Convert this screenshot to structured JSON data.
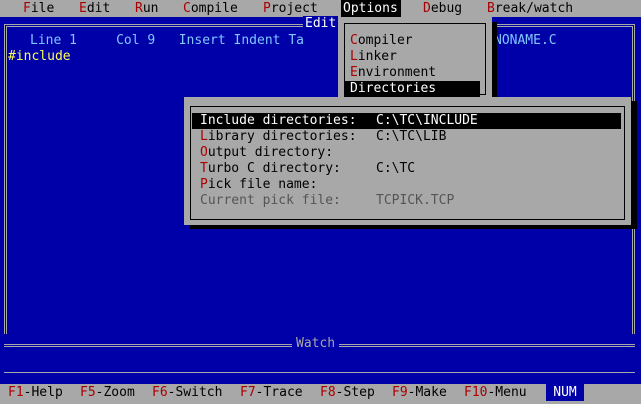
{
  "menubar": {
    "items": [
      {
        "hotkey": "F",
        "rest": "ile"
      },
      {
        "hotkey": "E",
        "rest": "dit"
      },
      {
        "hotkey": "R",
        "rest": "un"
      },
      {
        "hotkey": "C",
        "rest": "ompile"
      },
      {
        "hotkey": "P",
        "rest": "roject"
      },
      {
        "hotkey": "O",
        "rest": "ptions"
      },
      {
        "hotkey": "D",
        "rest": "ebug"
      },
      {
        "hotkey": "B",
        "rest": "reak/watch"
      }
    ],
    "active": "Options"
  },
  "edit_window": {
    "title": "Edit",
    "status": {
      "line": "Line 1",
      "col": "Col 9",
      "insert": "Insert",
      "indent": "Indent",
      "tab": "Ta"
    },
    "file_name": "NONAME.C",
    "content": "#include"
  },
  "options_menu": {
    "items": [
      {
        "hotkey": "C",
        "rest": "ompiler"
      },
      {
        "hotkey": "L",
        "rest": "inker"
      },
      {
        "hotkey": "E",
        "rest": "nvironment"
      },
      {
        "hotkey": "D",
        "rest": "irectories"
      }
    ],
    "selected": "Directories"
  },
  "directories_dialog": {
    "rows": [
      {
        "hotkey": "I",
        "rest": "nclude directories:",
        "value": "C:\\TC\\INCLUDE",
        "selected": true,
        "disabled": false
      },
      {
        "hotkey": "L",
        "rest": "ibrary directories:",
        "value": "C:\\TC\\LIB",
        "selected": false,
        "disabled": false
      },
      {
        "hotkey": "O",
        "rest": "utput directory:",
        "value": "",
        "selected": false,
        "disabled": false
      },
      {
        "hotkey": "T",
        "rest": "urbo C directory:",
        "value": "C:\\TC",
        "selected": false,
        "disabled": false
      },
      {
        "hotkey": "P",
        "rest": "ick file name:",
        "value": "",
        "selected": false,
        "disabled": false
      },
      {
        "hotkey": "",
        "rest": "Current pick file:",
        "value": "TCPICK.TCP",
        "selected": false,
        "disabled": true
      }
    ]
  },
  "watch_window": {
    "title": "Watch"
  },
  "function_keys": [
    {
      "key": "F1",
      "label": "-Help"
    },
    {
      "key": "F5",
      "label": "-Zoom"
    },
    {
      "key": "F6",
      "label": "-Switch"
    },
    {
      "key": "F7",
      "label": "-Trace"
    },
    {
      "key": "F8",
      "label": "-Step"
    },
    {
      "key": "F9",
      "label": "-Make"
    },
    {
      "key": "F10",
      "label": "-Menu"
    }
  ],
  "indicator": "NUM",
  "colors": {
    "background": "#0000a8",
    "menu_bg": "#a8a8a8",
    "hotkey": "#a80000",
    "editor_text": "#ffff55",
    "status_text": "#7ec8ff"
  }
}
